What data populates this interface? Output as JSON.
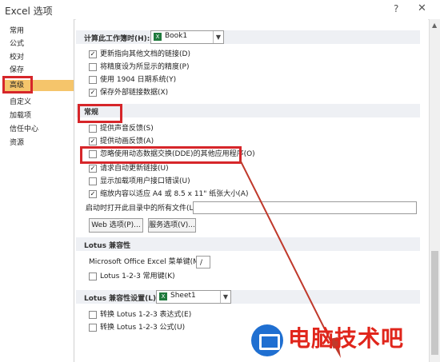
{
  "window": {
    "title": "Excel 选项",
    "help": "?",
    "close": "✕"
  },
  "sidebar": {
    "items": [
      {
        "label": "常用"
      },
      {
        "label": "公式"
      },
      {
        "label": "校对"
      },
      {
        "label": "保存"
      },
      {
        "label": "高级",
        "active": true
      },
      {
        "label": "自定义"
      },
      {
        "label": "加载项"
      },
      {
        "label": "信任中心"
      },
      {
        "label": "资源"
      }
    ]
  },
  "workbook_calc": {
    "label": "计算此工作簿时(H):",
    "workbook": "Book1",
    "options": [
      {
        "label": "更新指向其他文档的链接(D)",
        "checked": true
      },
      {
        "label": "将精度设为所显示的精度(P)",
        "checked": false
      },
      {
        "label": "使用 1904 日期系统(Y)",
        "checked": false
      },
      {
        "label": "保存外部链接数据(X)",
        "checked": true
      }
    ]
  },
  "general": {
    "heading": "常规",
    "options": [
      {
        "label": "提供声音反馈(S)",
        "checked": false
      },
      {
        "label": "提供动画反馈(A)",
        "checked": true
      },
      {
        "label": "忽略使用动态数据交换(DDE)的其他应用程序(O)",
        "checked": false
      },
      {
        "label": "请求自动更新链接(U)",
        "checked": true
      },
      {
        "label": "显示加载项用户接口错误(U)",
        "checked": false
      },
      {
        "label": "缩放内容以适应 A4 或 8.5 x 11\" 纸张大小(A)",
        "checked": true
      }
    ],
    "startup_label": "启动时打开此目录中的所有文件(L):",
    "startup_value": "",
    "web_button": "Web 选项(P)...",
    "service_button": "服务选项(V)..."
  },
  "lotus_compat": {
    "heading": "Lotus 兼容性",
    "menu_key_label": "Microsoft Office Excel 菜单键(M):",
    "menu_key_value": "/",
    "nav_keys_label": "Lotus 1-2-3 常用键(K)",
    "nav_keys_checked": false
  },
  "lotus_settings": {
    "heading": "Lotus 兼容性设置(L):",
    "sheet": "Sheet1",
    "options": [
      {
        "label": "转换 Lotus 1-2-3 表达式(E)",
        "checked": false
      },
      {
        "label": "转换 Lotus 1-2-3 公式(U)",
        "checked": false
      }
    ]
  },
  "watermark": {
    "text": "电脑技术吧"
  },
  "colors": {
    "highlight": "#d6262a",
    "active_nav": "#f5c56b",
    "section_bg": "#eef0f4",
    "watermark": "#e0251b"
  },
  "icons": {
    "help": "question-mark",
    "close": "close-x",
    "excel": "excel-sheet-icon",
    "dropdown": "chevron-down"
  }
}
